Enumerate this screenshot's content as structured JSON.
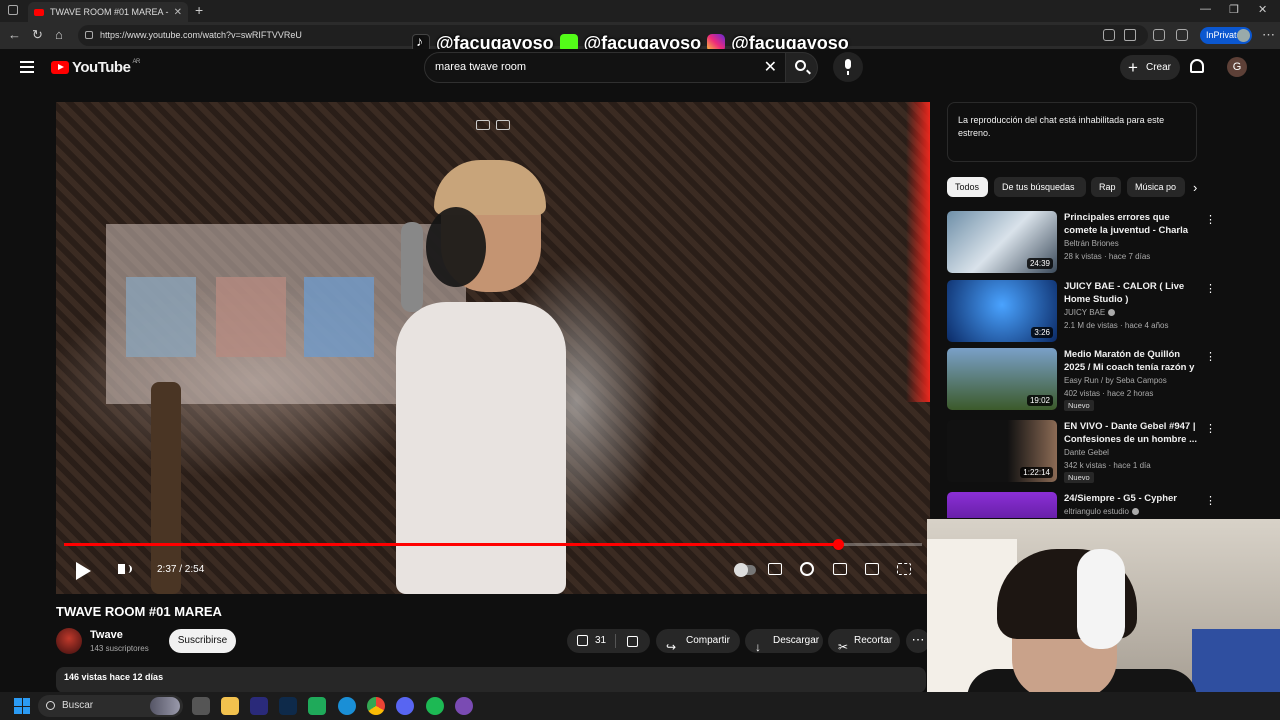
{
  "browser": {
    "tab_title": "TWAVE ROOM #01 MAREA - You",
    "url": "https://www.youtube.com/watch?v=swRIFTVVReU",
    "inprivate_label": "InPrivate"
  },
  "social_overlay": {
    "handles": [
      "@facugayoso",
      "@facugayoso",
      "@facugayoso"
    ],
    "icons": [
      "tiktok-icon",
      "kick-icon",
      "instagram-icon"
    ]
  },
  "header": {
    "logo_text": "YouTube",
    "region": "AR",
    "search_value": "marea twave room",
    "create_label": "Crear",
    "avatar_letter": "G"
  },
  "player": {
    "time": "2:37 / 2:54",
    "progress_fraction": 0.902
  },
  "video": {
    "title": "TWAVE ROOM #01 MAREA",
    "channel": "Twave",
    "subscribers": "143 suscriptores",
    "subscribe_label": "Suscribirse",
    "likes": "31",
    "share_label": "Compartir",
    "download_label": "Descargar",
    "clip_label": "Recortar",
    "views_age": "146 vistas  hace 12 días"
  },
  "sidebar": {
    "chat_note": "La reproducción del chat está inhabilitada para este estreno.",
    "chips": [
      "Todos",
      "De tus búsquedas",
      "Rap",
      "Música po"
    ],
    "recommendations": [
      {
        "title": "Principales errores que comete la juventud - Charla en el auto",
        "channel": "Beltrán Briones",
        "meta": "28 k vistas · hace 7 días",
        "duration": "24:39",
        "badge": "",
        "verified": false
      },
      {
        "title": "JUICY BAE - CALOR ( Live Home Studio )",
        "channel": "JUICY BAE",
        "meta": "2.1 M de vistas · hace 4 años",
        "duration": "3:26",
        "badge": "",
        "verified": true
      },
      {
        "title": "Medio Maratón de Quillón 2025 / Mi coach tenía razón y corrí ...",
        "channel": "Easy Run / by Seba Campos",
        "meta": "402 vistas · hace 2 horas",
        "duration": "19:02",
        "badge": "Nuevo",
        "verified": false
      },
      {
        "title": "EN VIVO - Dante Gebel #947 | Confesiones de un hombre ...",
        "channel": "Dante Gebel",
        "meta": "342 k vistas · hace 1 día",
        "duration": "1:22:14",
        "badge": "Nuevo",
        "verified": false
      },
      {
        "title": "24/Siempre - G5 - Cypher",
        "channel": "eltriangulo estudio",
        "meta": "",
        "duration": "",
        "badge": "",
        "verified": true
      }
    ]
  },
  "taskbar": {
    "search_placeholder": "Buscar"
  }
}
